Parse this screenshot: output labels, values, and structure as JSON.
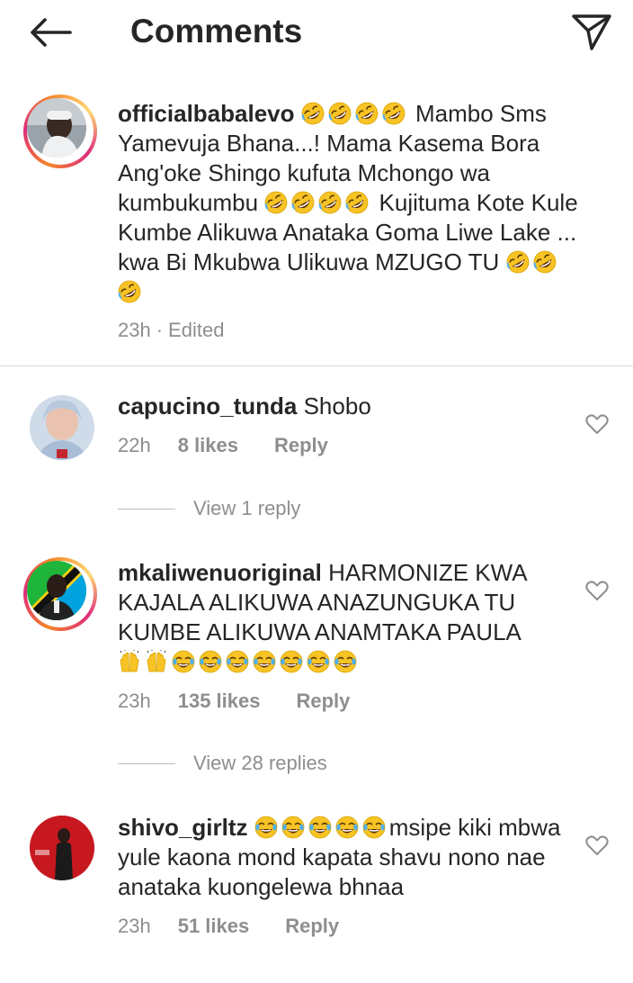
{
  "header": {
    "title": "Comments",
    "back_icon": "back-arrow-icon",
    "send_icon": "send-direct-icon"
  },
  "caption": {
    "username": "officialbabalevo",
    "text_1": " Mambo Sms Yamevuja Bhana...! Mama Kasema Bora Ang'oke Shingo kufuta Mchongo wa kumbukumbu ",
    "text_2": " Kujituma Kote Kule Kumbe Alikuwa Anataka Goma Liwe Lake ... kwa Bi Mkubwa Ulikuwa MZUGO TU ",
    "time": "23h",
    "edited": "Edited",
    "emoji": "rolling-on-floor-laughing"
  },
  "comments": [
    {
      "username": "capucino_tunda",
      "text": "Shobo",
      "time": "22h",
      "likes": "8 likes",
      "reply": "Reply",
      "view_replies": "View 1 reply"
    },
    {
      "username": "mkaliwenuoriginal",
      "text": "HARMONIZE KWA KAJALA ALIKUWA ANAZUNGUKA TU KUMBE ALIKUWA ANAMTAKA PAULA",
      "time": "23h",
      "likes": "135 likes",
      "reply": "Reply",
      "view_replies": "View 28 replies"
    },
    {
      "username": "shivo_girltz",
      "text": "msipe kiki mbwa yule kaona mond kapata shavu nono nae anataka kuongelewa bhnaa",
      "time": "23h",
      "likes": "51 likes",
      "reply": "Reply"
    }
  ],
  "colors": {
    "text": "#262626",
    "secondary": "#8e8e8e",
    "divider": "#dbdbdb",
    "emoji": "#f7b500"
  }
}
